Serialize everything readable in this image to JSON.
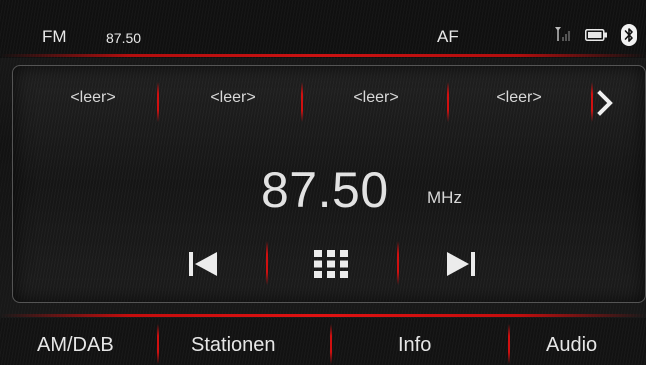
{
  "status": {
    "band": "FM",
    "frequency": "87.50",
    "af": "AF",
    "icons": [
      "signal-icon",
      "battery-icon",
      "bluetooth-icon"
    ]
  },
  "presets": [
    {
      "label": "<leer>"
    },
    {
      "label": "<leer>"
    },
    {
      "label": "<leer>"
    },
    {
      "label": "<leer>"
    }
  ],
  "main": {
    "frequency": "87.50",
    "unit": "MHz",
    "controls": [
      "previous-icon",
      "grid-menu-icon",
      "next-icon"
    ]
  },
  "tabs": [
    {
      "label": "AM/DAB"
    },
    {
      "label": "Stationen"
    },
    {
      "label": "Info"
    },
    {
      "label": "Audio"
    }
  ],
  "colors": {
    "accent": "#d01010",
    "background": "#151515",
    "text": "#e6e6e6"
  }
}
